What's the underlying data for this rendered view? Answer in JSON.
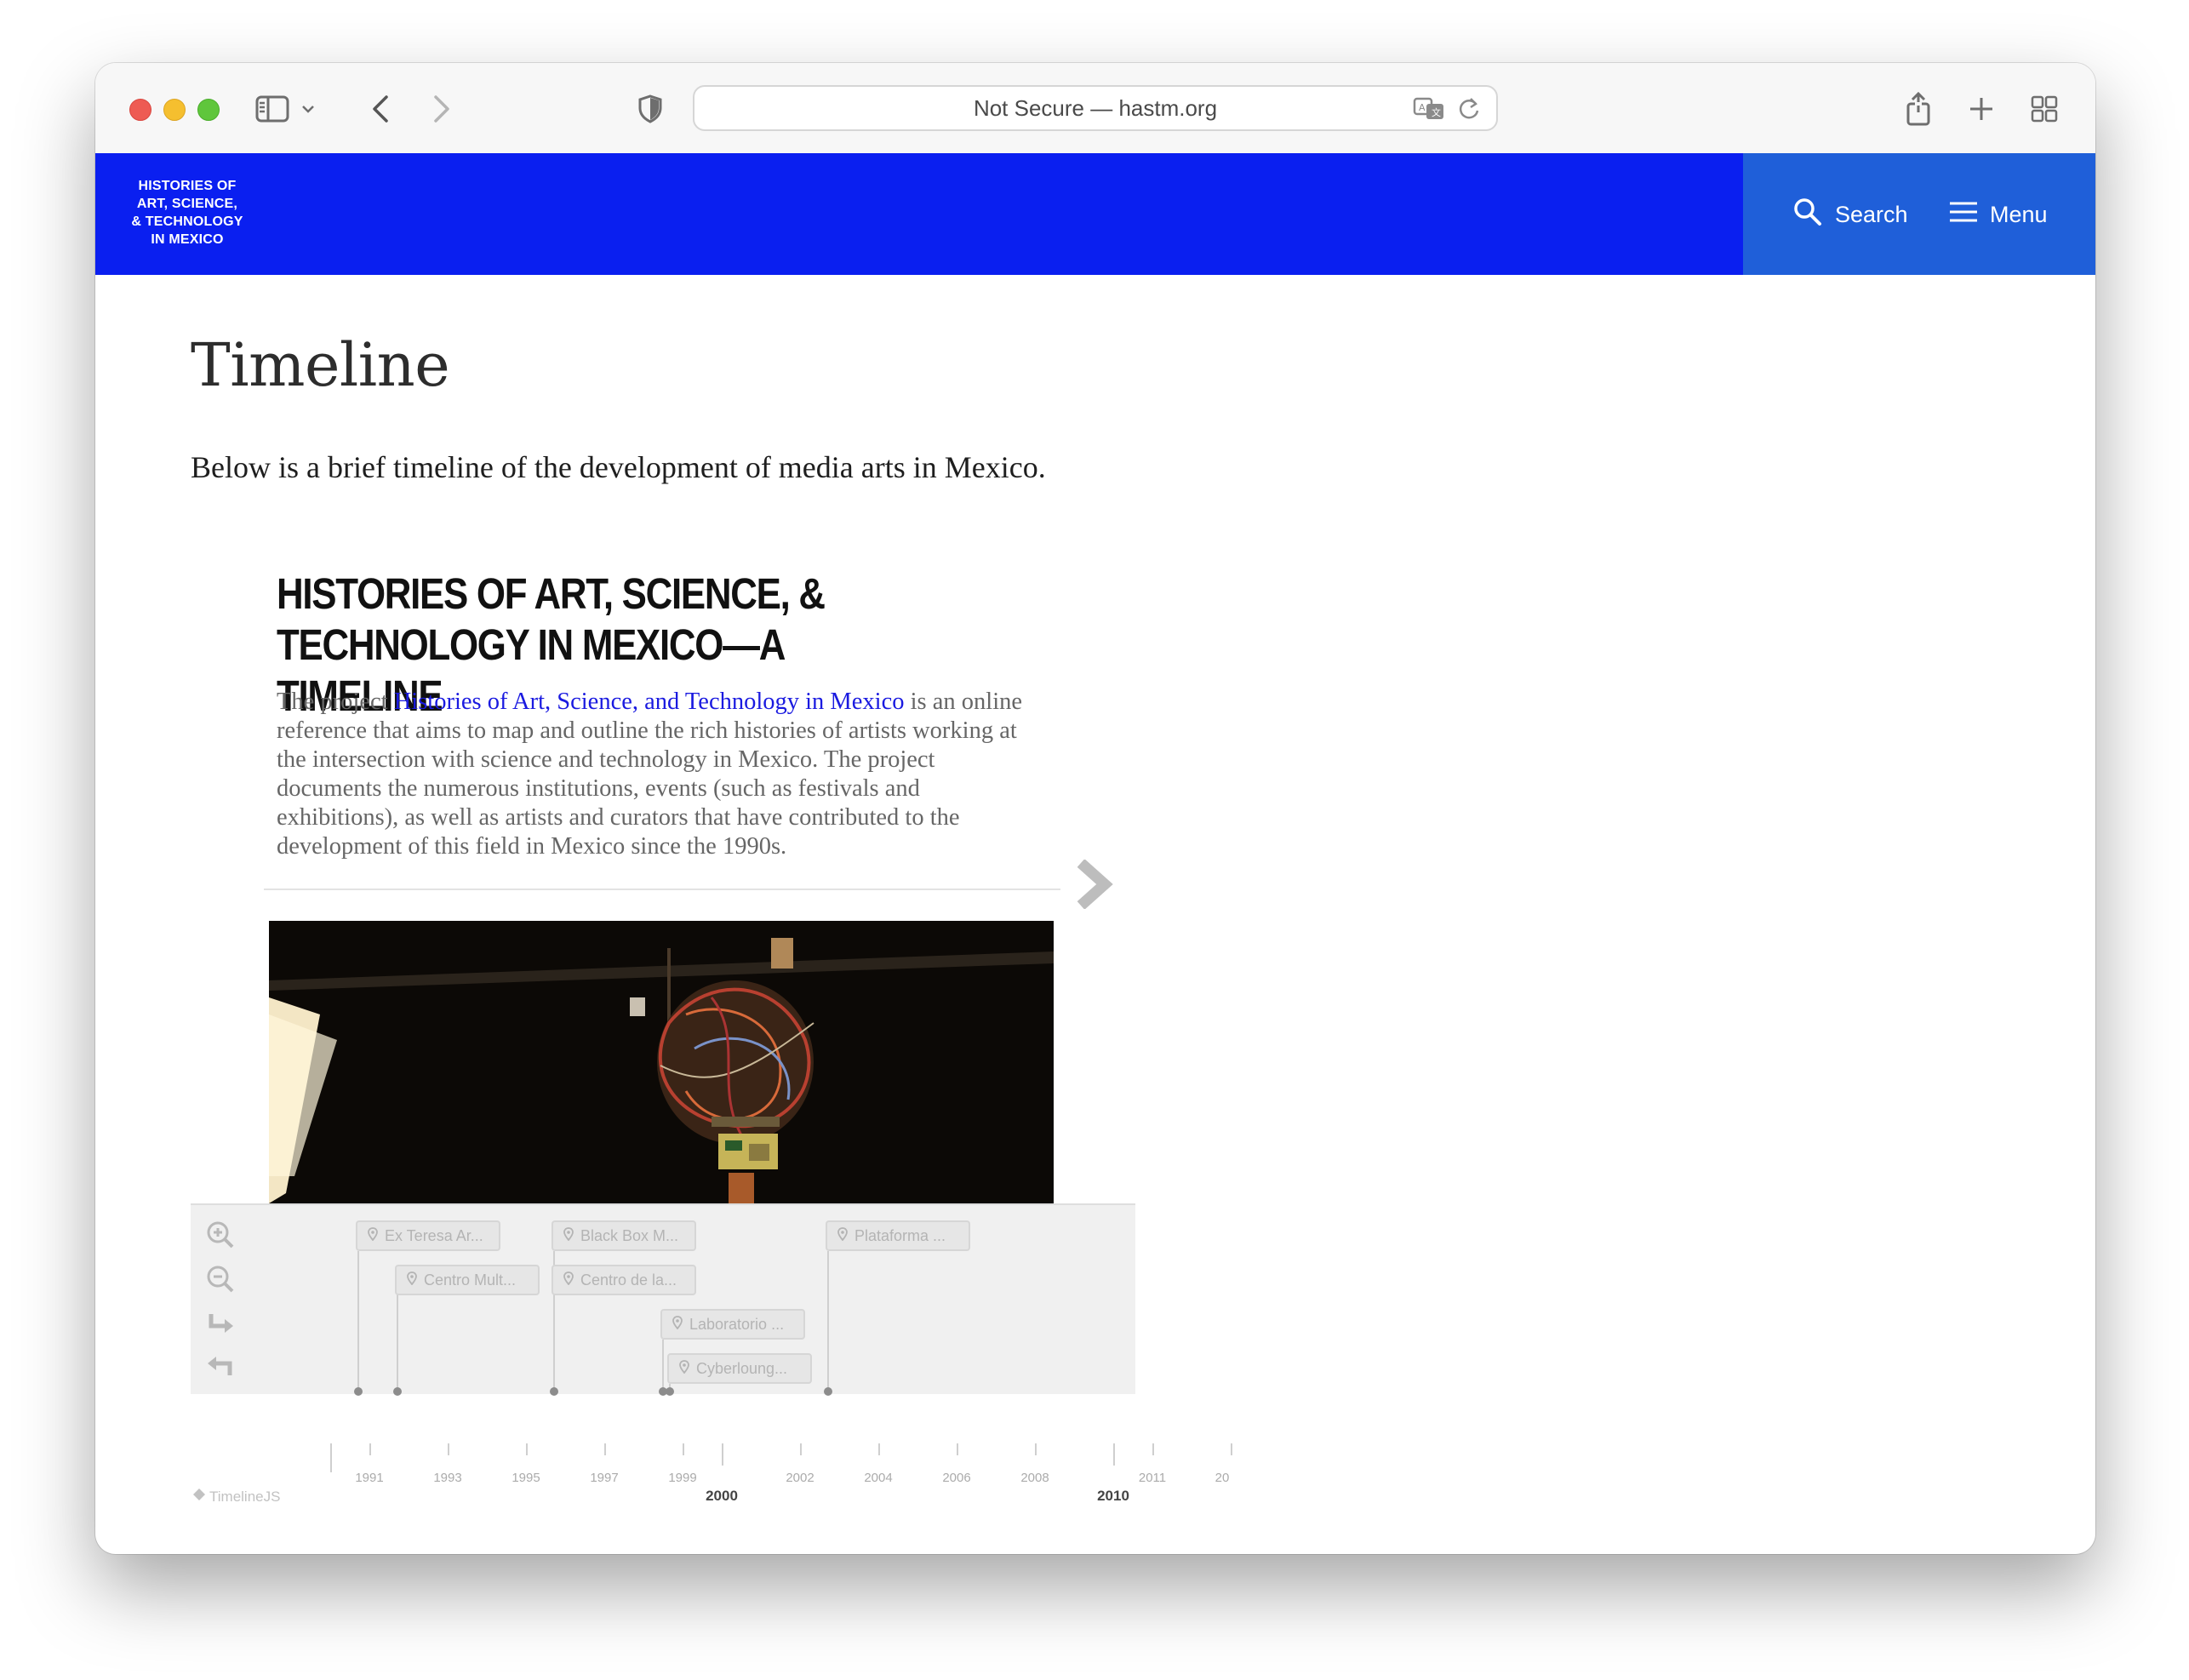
{
  "browser": {
    "url_text": "Not Secure — hastm.org"
  },
  "site": {
    "logo_lines": [
      "HISTORIES OF",
      "ART, SCIENCE,",
      "& TECHNOLOGY",
      "IN MEXICO"
    ],
    "search_label": "Search",
    "menu_label": "Menu",
    "header_color": "#0a1ff0",
    "nav_panel_color": "#1f5fd9"
  },
  "page": {
    "title": "Timeline",
    "intro": "Below is a brief timeline of the development of media arts in Mexico."
  },
  "timeline": {
    "heading": "Histories of Art, Science, & Technology in Mexico—A Timeline",
    "body_prefix": "The project ",
    "body_link": "Histories of Art, Science, and Technology in Mexico",
    "body_suffix": " is an online reference that aims to map and outline the rich histories of artists working at the intersection with science and technology in Mexico. The project documents the numerous institutions, events (such as festivals and exhibitions), as well as artists and curators that have contributed to the development of this field in Mexico since the 1990s.",
    "events": [
      "Ex Teresa Ar...",
      "Centro Mult...",
      "Black Box M...",
      "Centro de la...",
      "Laboratorio ...",
      "Cyberloung...",
      "Plataforma ..."
    ],
    "axis_minor_labels": [
      "1991",
      "1993",
      "1995",
      "1997",
      "1999",
      "2002",
      "2004",
      "2006",
      "2008",
      "2011",
      "20"
    ],
    "axis_major_labels": [
      "2000",
      "2010"
    ],
    "credit": "TimelineJS"
  }
}
